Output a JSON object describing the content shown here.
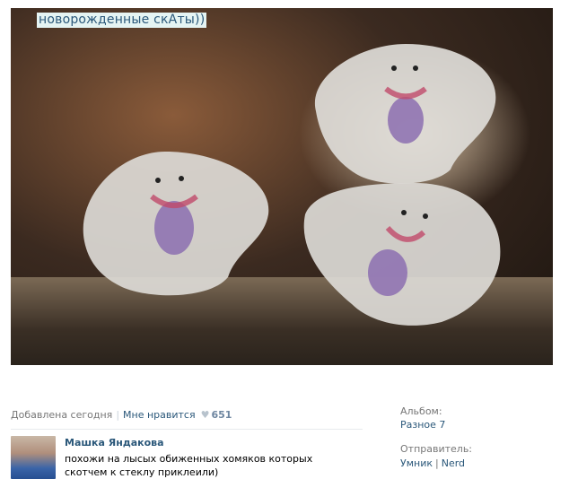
{
  "photo": {
    "caption": "новорожденные скАты))"
  },
  "meta": {
    "added": "Добавлена сегодня",
    "like_label": "Мне нравится",
    "like_count": "651"
  },
  "comment": {
    "author": "Машка Яндакова",
    "text": "похожи на лысых обиженных хомяков которых скотчем к стеклу приклеили)"
  },
  "side": {
    "album_label": "Альбом:",
    "album_value": "Разное 7",
    "sender_label": "Отправитель:",
    "sender_name": "Умник",
    "sender_nick": "Nerd"
  },
  "colors": {
    "link": "#2b587a",
    "muted": "#777777",
    "caption_bg": "#e5f4f3"
  }
}
